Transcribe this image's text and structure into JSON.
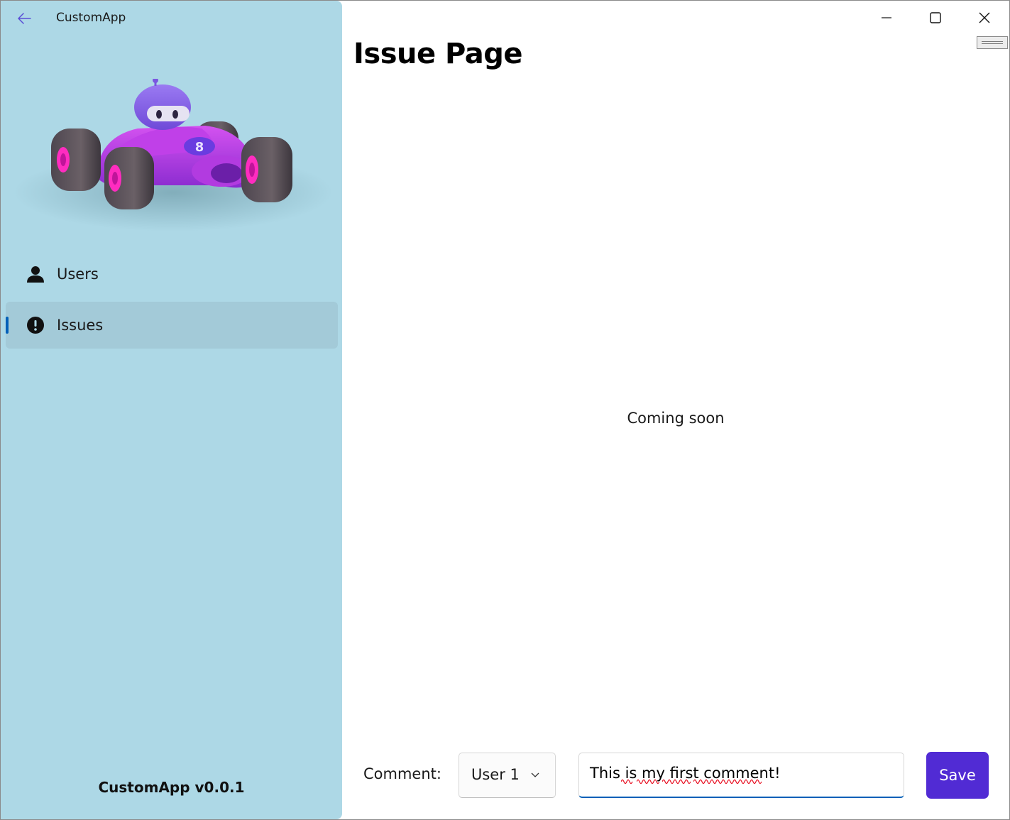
{
  "app": {
    "title": "CustomApp",
    "version": "CustomApp v0.0.1"
  },
  "sidebar": {
    "items": [
      {
        "label": "Users",
        "icon": "person-icon",
        "selected": false
      },
      {
        "label": "Issues",
        "icon": "exclamation-icon",
        "selected": true
      }
    ],
    "background_color": "#add8e6",
    "selection_indicator_color": "#005fb8"
  },
  "page": {
    "title": "Issue Page",
    "placeholder_text": "Coming soon"
  },
  "comment_form": {
    "label": "Comment:",
    "user_select_value": "User 1",
    "comment_value": "This is my first comment!",
    "save_label": "Save",
    "save_color": "#512bd4"
  },
  "caption_buttons": [
    "minimize-icon",
    "maximize-icon",
    "close-icon"
  ]
}
